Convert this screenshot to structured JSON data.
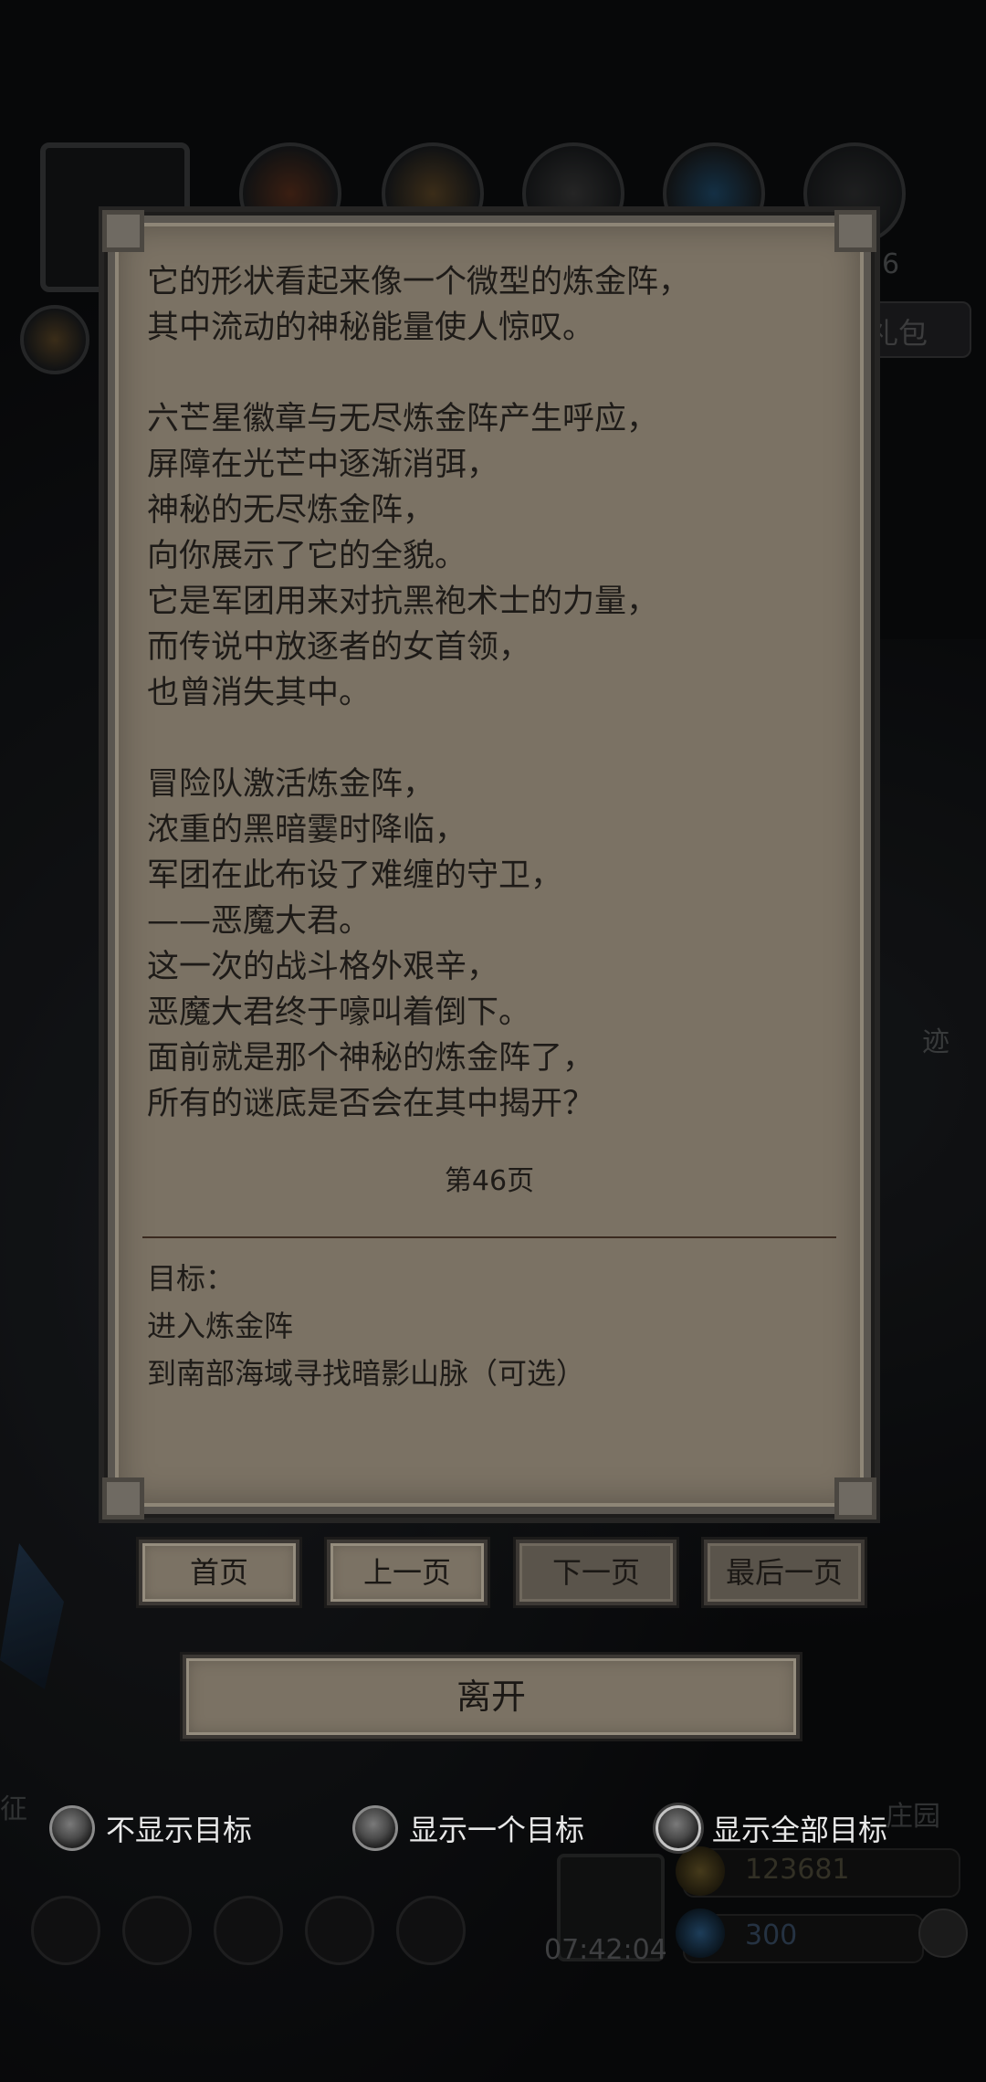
{
  "story_lines": [
    "它的形状看起来像一个微型的炼金阵，",
    "其中流动的神秘能量使人惊叹。",
    "",
    "六芒星徽章与无尽炼金阵产生呼应，",
    "屏障在光芒中逐渐消弭，",
    "神秘的无尽炼金阵，",
    "向你展示了它的全貌。",
    "它是军团用来对抗黑袍术士的力量，",
    "而传说中放逐者的女首领，",
    "也曾消失其中。",
    "",
    "冒险队激活炼金阵，",
    "浓重的黑暗霎时降临，",
    "军团在此布设了难缠的守卫，",
    "——恶魔大君。",
    "这一次的战斗格外艰辛，",
    "恶魔大君终于嚎叫着倒下。",
    "面前就是那个神秘的炼金阵了，",
    "所有的谜底是否会在其中揭开？"
  ],
  "page_label": "第46页",
  "goals": {
    "heading": "目标：",
    "items": [
      "进入炼金阵",
      "到南部海域寻找暗影山脉（可选）"
    ]
  },
  "nav": {
    "first": "首页",
    "prev": "上一页",
    "next": "下一页",
    "last": "最后一页"
  },
  "leave_label": "离开",
  "goal_display": {
    "options": [
      "不显示目标",
      "显示一个目标",
      "显示全部目标"
    ],
    "selected": "显示全部目标"
  },
  "background": {
    "gift_label": "礼包",
    "side_text_1": "迹",
    "left_text": "征",
    "right_text": "庄园",
    "gold": "123681",
    "gems": "300",
    "clock": "07:42:04",
    "level_fragment": "6"
  }
}
